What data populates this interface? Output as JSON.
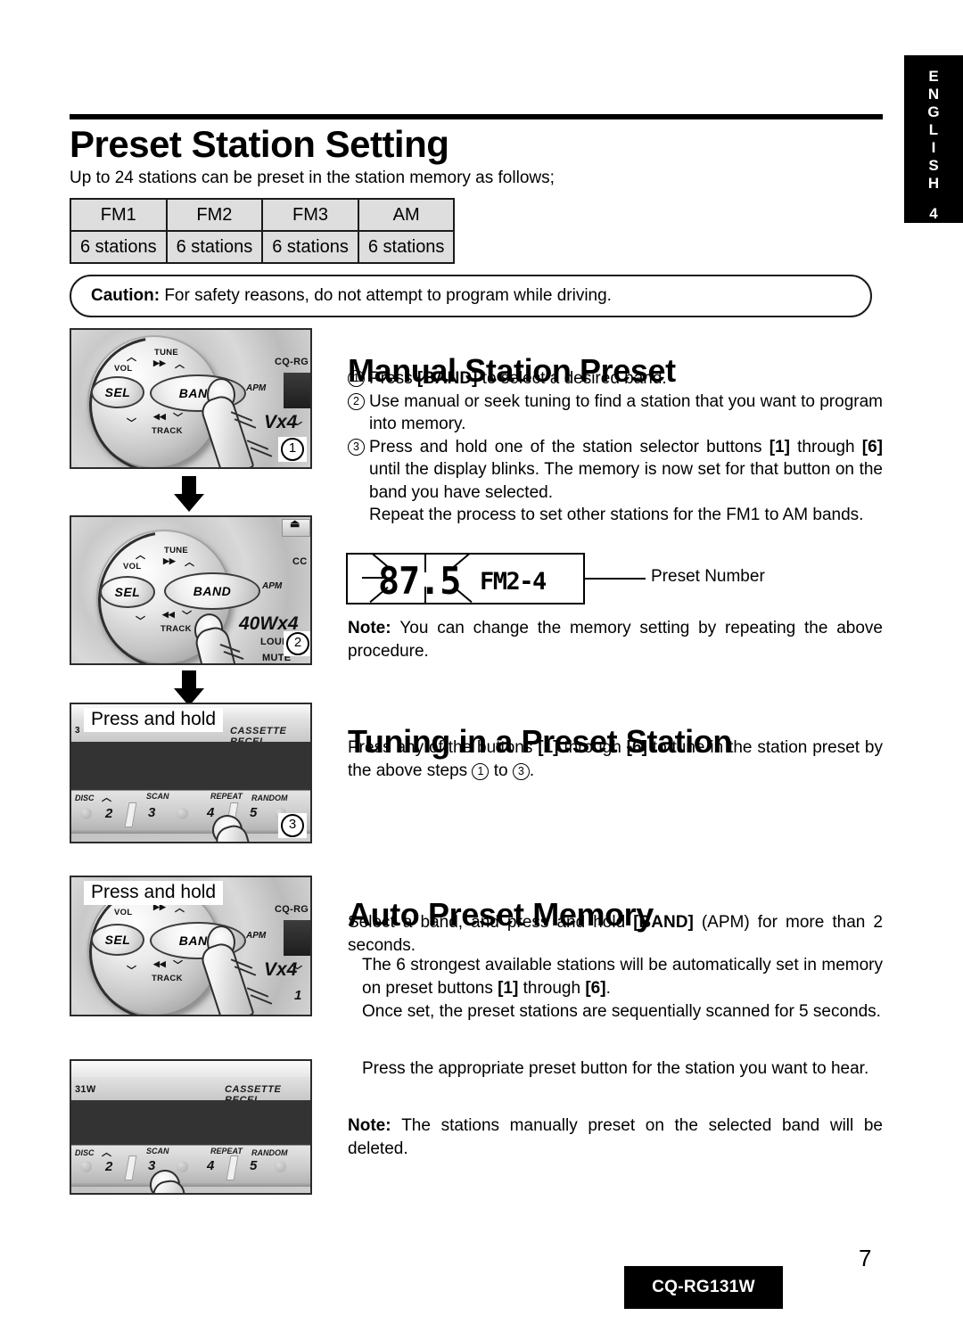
{
  "language_tab": {
    "letters": [
      "E",
      "N",
      "G",
      "L",
      "I",
      "S",
      "H"
    ],
    "section_number": "4"
  },
  "header": {
    "title": "Preset Station Setting",
    "subtitle": "Up to 24 stations can be preset in the station memory as follows;"
  },
  "band_table": {
    "headers": [
      "FM1",
      "FM2",
      "FM3",
      "AM"
    ],
    "values": [
      "6 stations",
      "6 stations",
      "6 stations",
      "6 stations"
    ]
  },
  "caution": {
    "label": "Caution:",
    "text": "For safety reasons, do not attempt to program while driving."
  },
  "manual_preset": {
    "heading": "Manual Station Preset",
    "steps": [
      {
        "marker": "1",
        "text_parts": [
          "Press ",
          "[BAND]",
          " to select a desired band."
        ]
      },
      {
        "marker": "2",
        "text": "Use manual or seek tuning to find a station that you want to program into memory."
      },
      {
        "marker": "3",
        "text_a": "Press and hold one of the station selector buttons ",
        "bold_a": "[1]",
        "text_b": " through ",
        "bold_b": "[6]",
        "text_c": " until the display blinks. The memory is now set for that button on the band you have selected."
      }
    ],
    "repeat_text": "Repeat the process to set other stations for the FM1 to AM bands.",
    "note_label": "Note:",
    "note_text": "You can change the memory setting by repeating the above procedure."
  },
  "lcd_display": {
    "frequency": "87.5",
    "band_preset": "FM2-4",
    "callout": "Preset Number"
  },
  "tuning_preset": {
    "heading": "Tuning in a Preset Station",
    "text_a": "Press any of the buttons ",
    "bold_a": "[1]",
    "text_b": " through ",
    "bold_b": "[6]",
    "text_c": " to tune in the station preset by the above steps ",
    "step_from": "1",
    "text_d": " to ",
    "step_to": "3",
    "text_e": "."
  },
  "auto_preset": {
    "heading": "Auto Preset Memory",
    "intro_a": "Select a band, and press and hold ",
    "intro_bold": "[BAND]",
    "intro_b": " (APM) for more than 2 seconds.",
    "para1_a": "The 6 strongest available stations will be automatically set in memory on preset buttons ",
    "para1_bold_a": "[1]",
    "para1_b": " through ",
    "para1_bold_b": "[6]",
    "para1_c": ".",
    "para2": "Once set, the preset stations are sequentially scanned for 5 seconds.",
    "para3": "Press the appropriate preset button for the station you want to hear.",
    "note_label": "Note:",
    "note_text": "The stations manually preset on the selected band will be deleted."
  },
  "illustrations": {
    "panel1": {
      "buttons": [
        "SEL",
        "BAND"
      ],
      "labels": [
        "VOL",
        "TUNE",
        "TRACK",
        "APM",
        "CQ-RG"
      ],
      "power_label": "Vx4",
      "step_badge": "1"
    },
    "panel2": {
      "buttons": [
        "SEL",
        "BAND"
      ],
      "labels": [
        "VOL",
        "TUNE",
        "TRACK",
        "APM",
        "CC"
      ],
      "power_label": "40Wx4",
      "extra_labels": [
        "LOUD",
        "MUTE"
      ],
      "step_badge": "2"
    },
    "panel3": {
      "overlay": "Press and hold",
      "receiver_label": "CASSETTE RECEI",
      "model_fragment": "3",
      "function_labels": [
        "DISC",
        "SCAN",
        "REPEAT",
        "RANDOM"
      ],
      "preset_numbers": [
        "2",
        "3",
        "4",
        "5"
      ],
      "step_badge": "3"
    },
    "panel4": {
      "overlay": "Press and hold",
      "buttons": [
        "SEL",
        "BAND"
      ],
      "labels": [
        "VOL",
        "TRACK",
        "APM",
        "CQ-RG"
      ],
      "power_label": "Vx4",
      "preset_number": "1"
    },
    "panel5": {
      "model_fragment": "31W",
      "receiver_label": "CASSETTE RECEI",
      "function_labels": [
        "DISC",
        "SCAN",
        "REPEAT",
        "RANDOM"
      ],
      "preset_numbers": [
        "2",
        "3",
        "4",
        "5"
      ]
    }
  },
  "footer": {
    "page_number": "7",
    "model": "CQ-RG131W"
  }
}
